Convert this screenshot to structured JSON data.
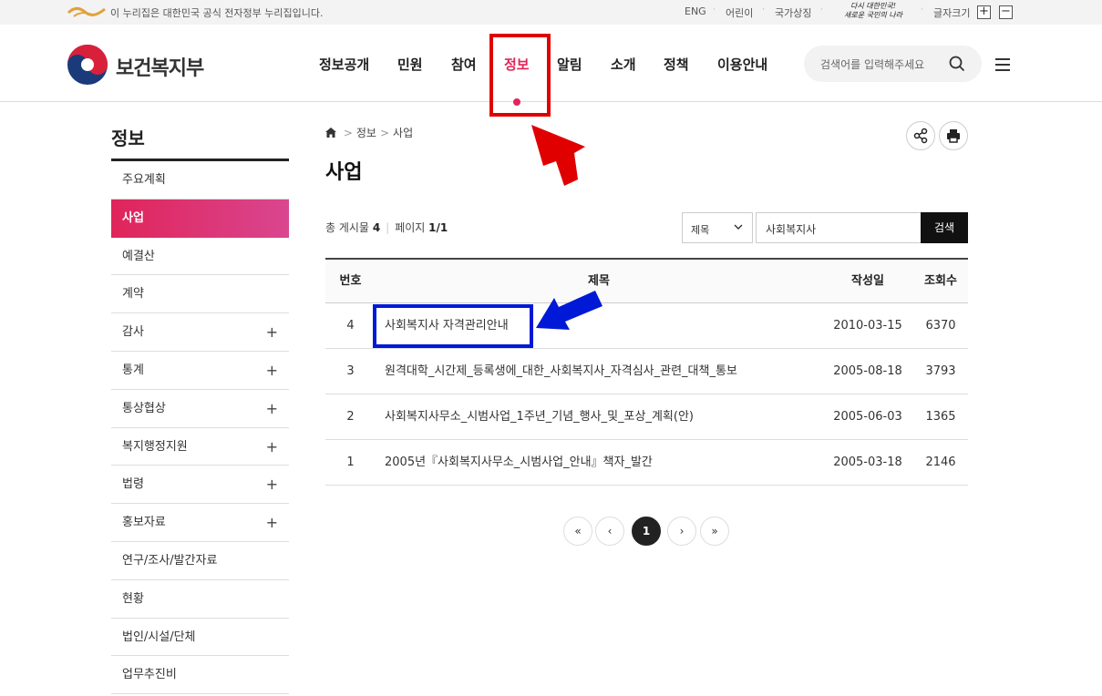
{
  "govbar": {
    "notice": "이 누리집은 대한민국 공식 전자정부 누리집입니다.",
    "links": [
      "ENG",
      "어린이",
      "국가상징"
    ],
    "slogan_line1": "다시 대한민국!",
    "slogan_line2": "새로운 국민의 나라",
    "font_size_label": "글자크기",
    "font_plus": "+",
    "font_minus": "−"
  },
  "header": {
    "logo_text": "보건복지부",
    "nav": [
      "정보공개",
      "민원",
      "참여",
      "정보",
      "알림",
      "소개",
      "정책",
      "이용안내"
    ],
    "nav_active": "정보",
    "search_placeholder": "검색어를 입력해주세요"
  },
  "sidebar": {
    "title": "정보",
    "items": [
      {
        "label": "주요계획",
        "expandable": false
      },
      {
        "label": "사업",
        "expandable": false,
        "active": true
      },
      {
        "label": "예결산",
        "expandable": false
      },
      {
        "label": "계약",
        "expandable": false
      },
      {
        "label": "감사",
        "expandable": true
      },
      {
        "label": "통계",
        "expandable": true
      },
      {
        "label": "통상협상",
        "expandable": true
      },
      {
        "label": "복지행정지원",
        "expandable": true
      },
      {
        "label": "법령",
        "expandable": true
      },
      {
        "label": "홍보자료",
        "expandable": true
      },
      {
        "label": "연구/조사/발간자료",
        "expandable": false
      },
      {
        "label": "현황",
        "expandable": false
      },
      {
        "label": "법인/시설/단체",
        "expandable": false
      },
      {
        "label": "업무추진비",
        "expandable": false
      }
    ],
    "plus": "+"
  },
  "content": {
    "breadcrumb": [
      "정보",
      "사업"
    ],
    "breadcrumb_sep": ">",
    "title": "사업",
    "total_label": "총 게시물",
    "total_value": "4",
    "page_label": "페이지",
    "page_value": "1/1",
    "search_field": "제목",
    "search_keyword": "사회복지사",
    "search_button": "검색",
    "table": {
      "headers": [
        "번호",
        "제목",
        "작성일",
        "조회수"
      ],
      "rows": [
        {
          "no": "4",
          "title": "사회복지사 자격관리안내",
          "date": "2010-03-15",
          "views": "6370"
        },
        {
          "no": "3",
          "title": "원격대학_시간제_등록생에_대한_사회복지사_자격심사_관련_대책_통보",
          "date": "2005-08-18",
          "views": "3793"
        },
        {
          "no": "2",
          "title": "사회복지사무소_시범사업_1주년_기념_행사_및_포상_계획(안)",
          "date": "2005-06-03",
          "views": "1365"
        },
        {
          "no": "1",
          "title": "2005년『사회복지사무소_시범사업_안내』책자_발간",
          "date": "2005-03-18",
          "views": "2146"
        }
      ]
    },
    "pagination": {
      "first": "«",
      "prev": "‹",
      "current": "1",
      "next": "›",
      "last": "»"
    }
  },
  "colors": {
    "accent": "#e2245a",
    "annotation_red": "#e00000",
    "annotation_blue": "#0019d6"
  }
}
